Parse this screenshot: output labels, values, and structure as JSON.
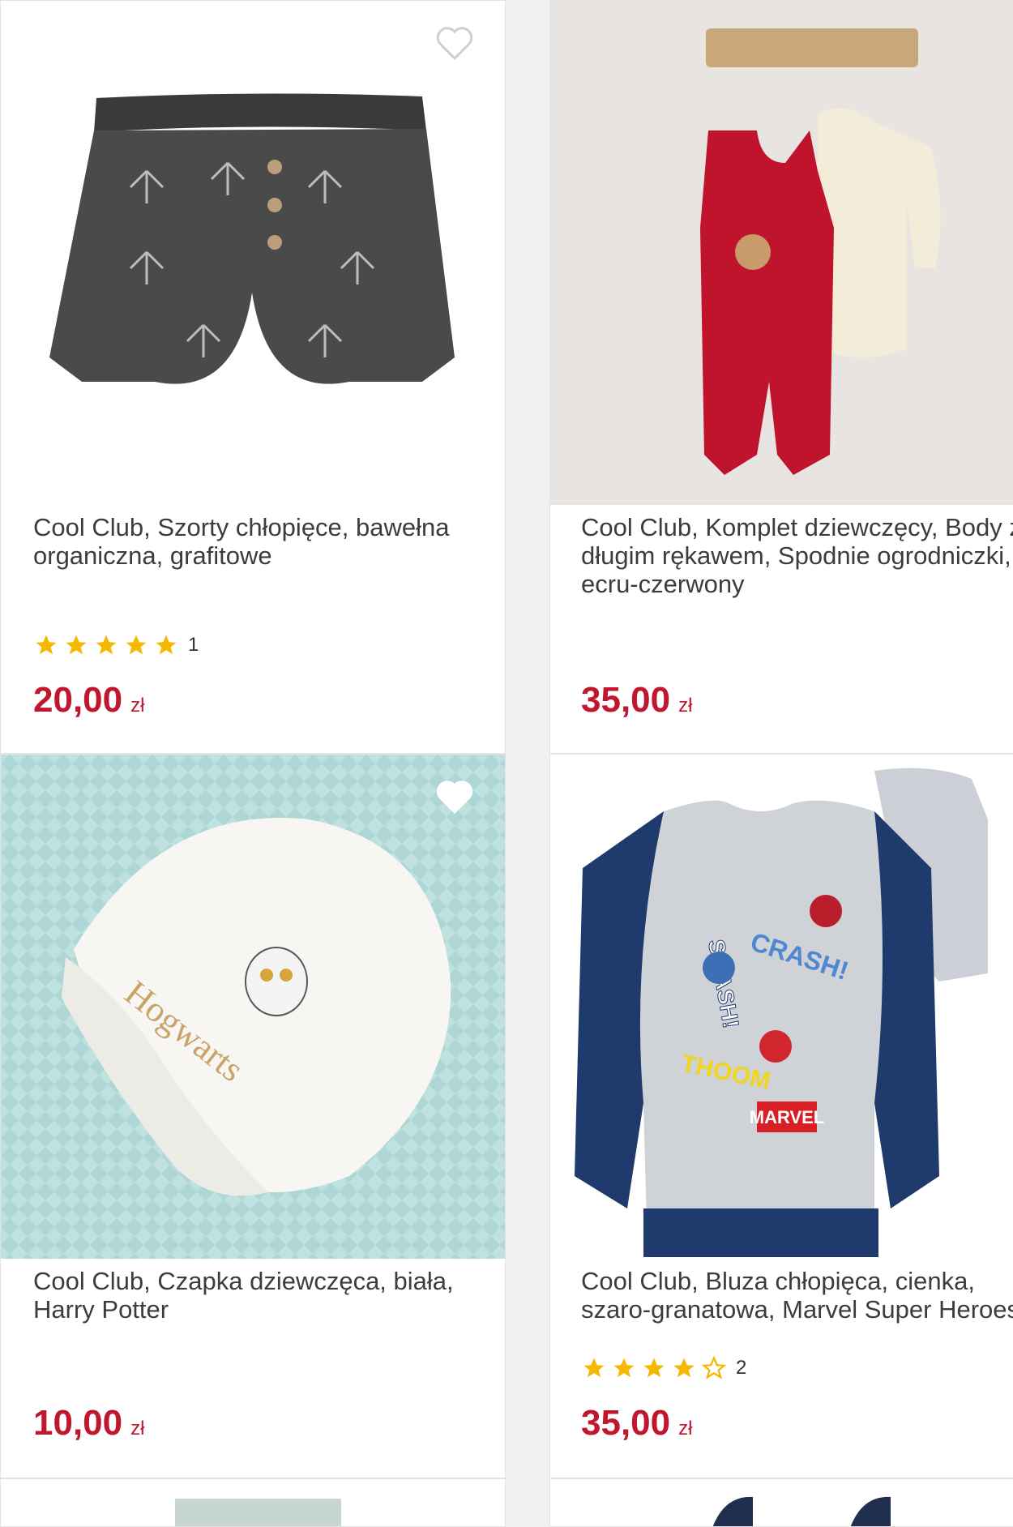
{
  "products": [
    {
      "title": "Cool Club, Szorty chłopięce, bawełna organiczna, grafitowe",
      "rating": 5,
      "review_count": "1",
      "price": "20,00",
      "currency": "zł"
    },
    {
      "title": "Cool Club, Komplet dziewczęcy, Body z długim rękawem, Spodnie ogrodniczki, ecru-czerwony",
      "price": "35,00",
      "currency": "zł"
    },
    {
      "title": "Cool Club, Czapka dziewczęca, biała, Harry Potter",
      "price": "10,00",
      "currency": "zł",
      "image_text": "Hogwarts"
    },
    {
      "title": "Cool Club, Bluza chłopięca, cienka, szaro-granatowa, Marvel Super Heroes",
      "rating": 4,
      "review_count": "2",
      "price": "35,00",
      "currency": "zł",
      "image_text": [
        "SMASH!",
        "CRASH!",
        "THOOM",
        "MARVEL"
      ]
    }
  ],
  "colors": {
    "price": "#c0172f",
    "star": "#f5b800",
    "text": "#3c3c3c"
  },
  "icons": {
    "favorite": "heart-outline-icon",
    "star_full": "star-filled-icon",
    "star_empty": "star-outline-icon"
  }
}
